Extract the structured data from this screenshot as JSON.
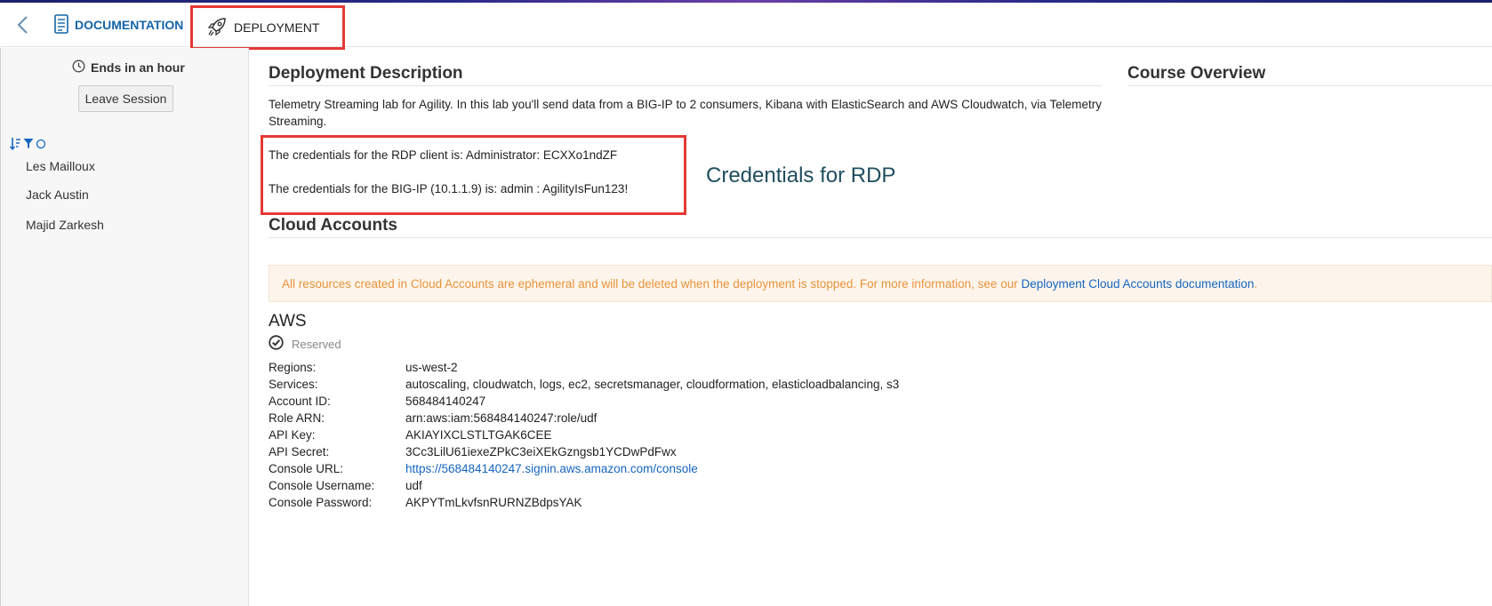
{
  "topbar": {
    "tab_documentation": "DOCUMENTATION",
    "tab_deployment": "DEPLOYMENT"
  },
  "sidebar": {
    "ends_text": "Ends in an hour",
    "leave_button": "Leave Session",
    "users": [
      "Les Mailloux",
      "Jack Austin",
      "Majid Zarkesh"
    ]
  },
  "main": {
    "description_heading": "Deployment Description",
    "course_heading": "Course Overview",
    "description_text": "Telemetry Streaming lab for Agility. In this lab you'll send data from a BIG-IP to 2 consumers, Kibana with ElasticSearch and AWS Cloudwatch, via Telemetry Streaming.",
    "cred_rdp": "The credentials for the RDP client is: Administrator: ECXXo1ndZF",
    "cred_bigip": "The credentials for the BIG-IP (10.1.1.9) is: admin : AgilityIsFun123!",
    "annotation": "Credentials for RDP",
    "cloud_heading": "Cloud Accounts",
    "notice_text": "All resources created in Cloud Accounts are ephemeral and will be deleted when the deployment is stopped. For more information, see our ",
    "notice_link": "Deployment Cloud Accounts documentation",
    "notice_end": ".",
    "provider": "AWS",
    "status": "Reserved",
    "details": [
      {
        "key": "Regions:",
        "value": "us-west-2"
      },
      {
        "key": "Services:",
        "value": "autoscaling, cloudwatch, logs, ec2, secretsmanager, cloudformation, elasticloadbalancing, s3"
      },
      {
        "key": "Account ID:",
        "value": "568484140247"
      },
      {
        "key": "Role ARN:",
        "value": "arn:aws:iam:568484140247:role/udf"
      },
      {
        "key": "API Key:",
        "value": "AKIAYIXCLSTLTGAK6CEE"
      },
      {
        "key": "API Secret:",
        "value": "3Cc3LilU61iexeZPkC3eiXEkGzngsb1YCDwPdFwx"
      },
      {
        "key": "Console URL:",
        "value": "https://568484140247.signin.aws.amazon.com/console"
      },
      {
        "key": "Console Username:",
        "value": "udf"
      },
      {
        "key": "Console Password:",
        "value": "AKPYTmLkvfsnRURNZBdpsYAK"
      }
    ]
  },
  "colors": {
    "link": "#1565c0",
    "highlight_box": "#e53935",
    "notice_text": "#e8933a",
    "notice_bg": "#fdf5ec"
  },
  "icons": [
    "back-icon",
    "documentation-icon",
    "rocket-icon",
    "clock-icon",
    "sort-icon",
    "filter-icon",
    "circle-icon",
    "check-circle-icon"
  ]
}
